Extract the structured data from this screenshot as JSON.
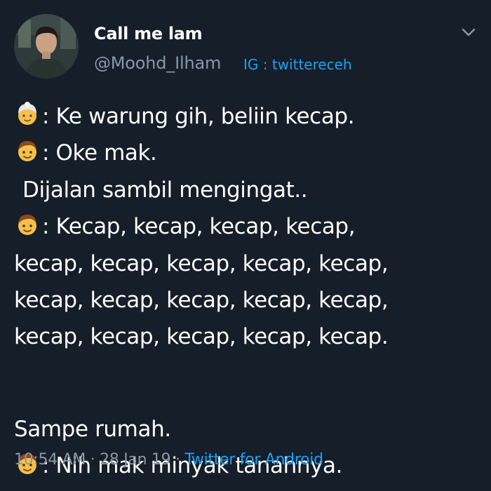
{
  "author": {
    "display_name": "Call me lam",
    "handle": "@Moohd_Ilham",
    "ig_tag": "IG : twittereceh"
  },
  "icons": {
    "avatar": "profile-photo",
    "menu": "chevron-down-icon",
    "grandma": "old-woman-emoji",
    "boy": "boy-emoji"
  },
  "tweet": {
    "lines": [
      {
        "speaker_icon": "grandma",
        "text": ": Ke warung gih, beliin kecap."
      },
      {
        "speaker_icon": "boy",
        "text": ": Oke mak."
      },
      {
        "speaker_icon": null,
        "text": "Dijalan sambil mengingat.."
      },
      {
        "speaker_icon": "boy",
        "text": ": Kecap, kecap, kecap, kecap,"
      },
      {
        "speaker_icon": null,
        "text": "kecap, kecap, kecap, kecap, kecap,"
      },
      {
        "speaker_icon": null,
        "text": "kecap, kecap, kecap, kecap, kecap,"
      },
      {
        "speaker_icon": null,
        "text": "kecap, kecap, kecap, kecap, kecap."
      },
      {
        "speaker_icon": null,
        "text": "Sampe rumah."
      },
      {
        "speaker_icon": "boy",
        "text": ": Nih mak minyak tanahnya."
      }
    ]
  },
  "meta": {
    "time": "10:54 AM",
    "date": "28 Jan 19",
    "separator": " · ",
    "source": "Twitter for Android"
  },
  "colors": {
    "background": "#151e29",
    "text": "#ffffff",
    "secondary": "#8899a6",
    "link": "#1da1f2"
  }
}
